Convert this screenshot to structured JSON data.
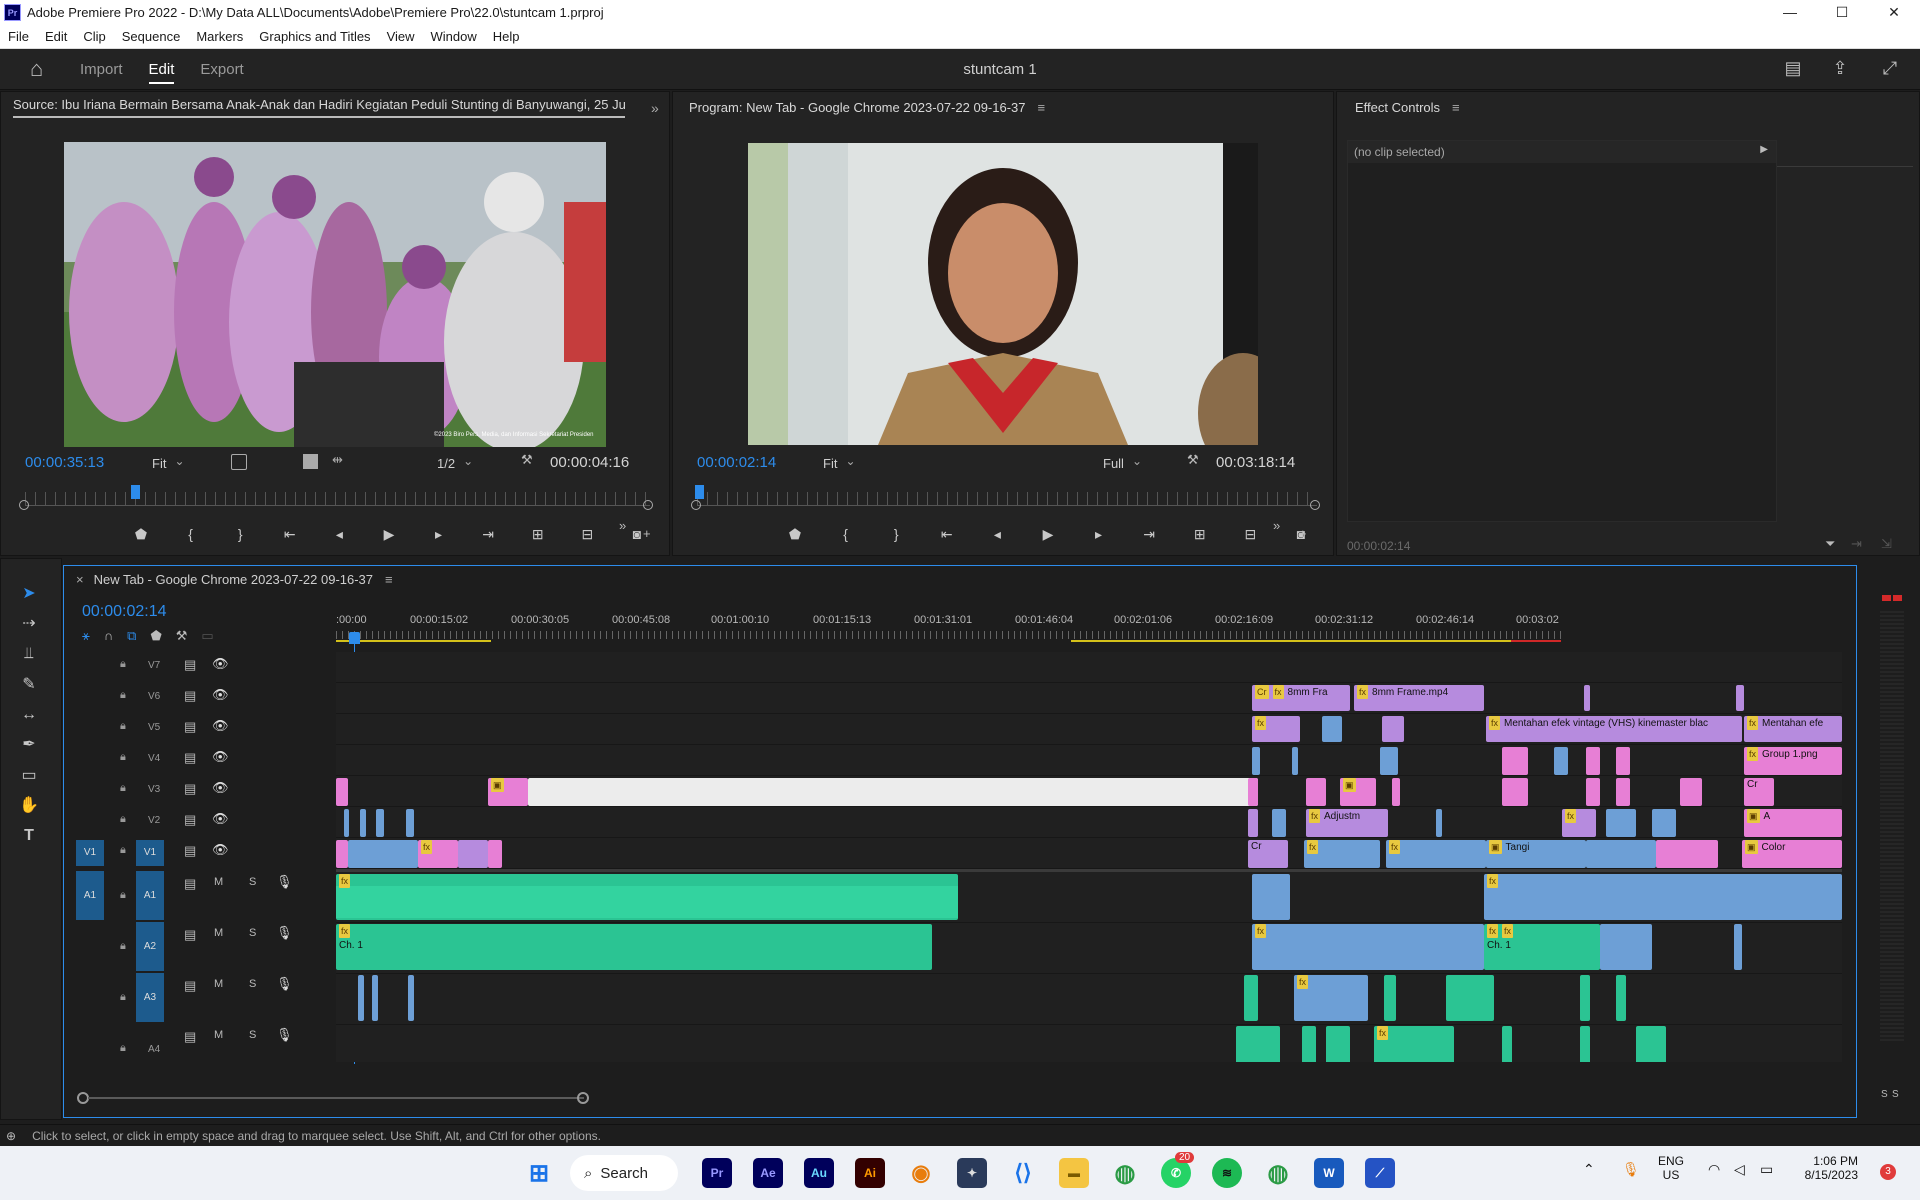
{
  "window": {
    "title": "Adobe Premiere Pro 2022 - D:\\My Data ALL\\Documents\\Adobe\\Premiere Pro\\22.0\\stuntcam 1.prproj",
    "app_icon": "Pr",
    "controls": {
      "minimize": "—",
      "maximize": "☐",
      "close": "✕"
    }
  },
  "menu": [
    "File",
    "Edit",
    "Clip",
    "Sequence",
    "Markers",
    "Graphics and Titles",
    "View",
    "Window",
    "Help"
  ],
  "workspace": {
    "tabs": [
      "Import",
      "Edit",
      "Export"
    ],
    "active_tab": "Edit",
    "project_name": "stuntcam 1"
  },
  "source_monitor": {
    "title": "Source: Ibu Iriana Bermain Bersama Anak-Anak dan Hadiri Kegiatan Peduli Stunting di Banyuwangi, 25 Jul",
    "timecode": "00:00:35:13",
    "zoom": "Fit",
    "resolution": "1/2",
    "duration": "00:00:04:16",
    "watermark": "©2023 Biro Pers, Media, dan Informasi Sekretariat Presiden",
    "playhead_fraction": 0.17
  },
  "program_monitor": {
    "title": "Program: New Tab - Google Chrome 2023-07-22 09-16-37",
    "timecode": "00:00:02:14",
    "zoom": "Fit",
    "resolution": "Full",
    "duration": "00:03:18:14",
    "playhead_fraction": 0.01
  },
  "effect_controls": {
    "title": "Effect Controls",
    "no_clip": "(no clip selected)",
    "timecode": "00:00:02:14"
  },
  "timeline": {
    "tab_title": "New Tab - Google Chrome 2023-07-22 09-16-37",
    "timecode": "00:00:02:14",
    "ruler": [
      ":00:00",
      "00:00:15:02",
      "00:00:30:05",
      "00:00:45:08",
      "00:01:00:10",
      "00:01:15:13",
      "00:01:31:01",
      "00:01:46:04",
      "00:02:01:06",
      "00:02:16:09",
      "00:02:31:12",
      "00:02:46:14",
      "00:03:02"
    ],
    "video_tracks": [
      "V7",
      "V6",
      "V5",
      "V4",
      "V3",
      "V2",
      "V1"
    ],
    "audio_tracks": [
      "A1",
      "A2",
      "A3",
      "A4"
    ],
    "source_patch_v": "V1",
    "source_patch_a": "A1",
    "track_buttons": {
      "mute": "M",
      "solo": "S"
    },
    "clip_labels": {
      "v6a": "8mm Fra",
      "v6b": "8mm Frame.mp4",
      "v5a": "Mentahan efek vintage (VHS) kinemaster blac",
      "v5b": "Mentahan efe",
      "v4a": "Group 1.png",
      "v2a": "Adjustm",
      "v2b": "A",
      "v1a": "Tangi",
      "v1b": "Color",
      "cr": "Cr",
      "ch": "Ch. 1"
    },
    "meter_labels": [
      "S",
      "S"
    ]
  },
  "status": {
    "hint": "Click to select, or click in empty space and drag to marquee select. Use Shift, Alt, and Ctrl for other options."
  },
  "taskbar": {
    "search": "Search",
    "apps": [
      "Pr",
      "Ae",
      "Au",
      "Ai"
    ],
    "whatsapp_badge": "20",
    "lang": "ENG",
    "region": "US",
    "time": "1:06 PM",
    "date": "8/15/2023",
    "notif_badge": "3"
  },
  "colors": {
    "accent_blue": "#2d8ceb",
    "clip_pink": "#e77fd5",
    "clip_violet": "#b68bde",
    "clip_blue": "#6d9fd6",
    "audio_green": "#2bc493"
  }
}
